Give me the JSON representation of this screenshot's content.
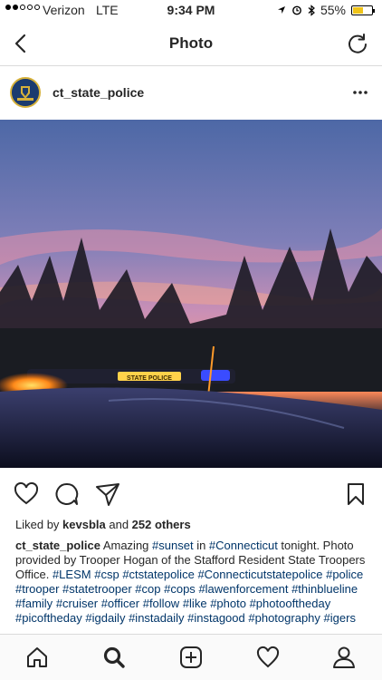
{
  "status_bar": {
    "carrier": "Verizon",
    "network": "LTE",
    "time": "9:34 PM",
    "battery_text": "55%",
    "battery_level": 0.55,
    "signal_bars": 2,
    "icons": [
      "location-icon",
      "alarm-icon",
      "bluetooth-icon",
      "battery-icon"
    ]
  },
  "nav": {
    "title": "Photo",
    "back_icon": "chevron-left-icon",
    "refresh_icon": "refresh-icon"
  },
  "post": {
    "username": "ct_state_police",
    "more_icon": "more-horizontal-icon",
    "photo_icon": "sunset-police-car-photo",
    "actions": [
      "heart-icon",
      "comment-icon",
      "share-icon",
      "bookmark-icon"
    ],
    "likes_prefix": "Liked by ",
    "likes_user": "kevsbla",
    "likes_connector": " and ",
    "likes_others": "252 others",
    "caption_user": "ct_state_police",
    "caption_segments": [
      {
        "text": " Amazing ",
        "tag": false
      },
      {
        "text": "#sunset",
        "tag": true
      },
      {
        "text": " in ",
        "tag": false
      },
      {
        "text": "#Connecticut",
        "tag": true
      },
      {
        "text": " tonight. Photo provided by Trooper Hogan of the Stafford Resident State Troopers Office. ",
        "tag": false
      },
      {
        "text": "#LESM",
        "tag": true
      },
      {
        "text": " ",
        "tag": false
      },
      {
        "text": "#csp",
        "tag": true
      },
      {
        "text": " ",
        "tag": false
      },
      {
        "text": "#ctstatepolice",
        "tag": true
      },
      {
        "text": " ",
        "tag": false
      },
      {
        "text": "#Connecticutstatepolice",
        "tag": true
      },
      {
        "text": " ",
        "tag": false
      },
      {
        "text": "#police",
        "tag": true
      },
      {
        "text": " ",
        "tag": false
      },
      {
        "text": "#trooper",
        "tag": true
      },
      {
        "text": " ",
        "tag": false
      },
      {
        "text": "#statetrooper",
        "tag": true
      },
      {
        "text": " ",
        "tag": false
      },
      {
        "text": "#cop",
        "tag": true
      },
      {
        "text": " ",
        "tag": false
      },
      {
        "text": "#cops",
        "tag": true
      },
      {
        "text": " ",
        "tag": false
      },
      {
        "text": "#lawenforcement",
        "tag": true
      },
      {
        "text": " ",
        "tag": false
      },
      {
        "text": "#thinblueline",
        "tag": true
      },
      {
        "text": " ",
        "tag": false
      },
      {
        "text": "#family",
        "tag": true
      },
      {
        "text": " ",
        "tag": false
      },
      {
        "text": "#cruiser",
        "tag": true
      },
      {
        "text": " ",
        "tag": false
      },
      {
        "text": "#officer",
        "tag": true
      },
      {
        "text": " ",
        "tag": false
      },
      {
        "text": "#follow",
        "tag": true
      },
      {
        "text": " ",
        "tag": false
      },
      {
        "text": "#like",
        "tag": true
      },
      {
        "text": " ",
        "tag": false
      },
      {
        "text": "#photo",
        "tag": true
      },
      {
        "text": " ",
        "tag": false
      },
      {
        "text": "#photooftheday",
        "tag": true
      },
      {
        "text": " ",
        "tag": false
      },
      {
        "text": "#picoftheday",
        "tag": true
      },
      {
        "text": " ",
        "tag": false
      },
      {
        "text": "#igdaily",
        "tag": true
      },
      {
        "text": " ",
        "tag": false
      },
      {
        "text": "#instadaily",
        "tag": true
      },
      {
        "text": " ",
        "tag": false
      },
      {
        "text": "#instagood",
        "tag": true
      },
      {
        "text": " ",
        "tag": false
      },
      {
        "text": "#photography",
        "tag": true
      },
      {
        "text": " ",
        "tag": false
      },
      {
        "text": "#igers",
        "tag": true
      }
    ]
  },
  "tab_bar": {
    "tabs": [
      "home-icon",
      "search-icon",
      "new-post-icon",
      "activity-heart-icon",
      "profile-icon"
    ],
    "active_tab": "search-icon"
  },
  "colors": {
    "hashtag": "#003569",
    "text": "#262626",
    "battery": "#f0c419",
    "divider": "#dbdbdb"
  }
}
